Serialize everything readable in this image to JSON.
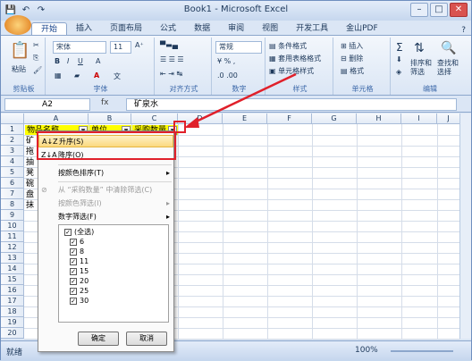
{
  "window": {
    "title": "Book1 - Microsoft Excel",
    "qat": [
      "save-icon",
      "undo-icon",
      "redo-icon"
    ],
    "controls": [
      "minimize-icon",
      "restore-icon",
      "close-icon"
    ]
  },
  "tabs": [
    "开始",
    "插入",
    "页面布局",
    "公式",
    "数据",
    "审阅",
    "视图",
    "开发工具",
    "金山PDF"
  ],
  "ribbon": {
    "clipboard": {
      "label": "剪贴板",
      "paste": "粘贴"
    },
    "font": {
      "label": "字体",
      "name": "宋体",
      "size": "11"
    },
    "alignment": {
      "label": "对齐方式"
    },
    "number": {
      "label": "数字",
      "format": "常规"
    },
    "styles": {
      "label": "样式",
      "conditional": "条件格式",
      "table": "套用表格格式",
      "cell": "单元格样式"
    },
    "cells": {
      "label": "单元格",
      "insert": "插入",
      "delete": "删除",
      "format": "格式"
    },
    "editing": {
      "label": "编辑",
      "sort": "排序和\n筛选",
      "find": "查找和\n选择"
    }
  },
  "formula_bar": {
    "name_box": "A2",
    "fx": "fx",
    "content": "矿泉水"
  },
  "grid": {
    "columns": [
      "A",
      "B",
      "C",
      "D",
      "E",
      "F",
      "G",
      "H",
      "I",
      "J"
    ],
    "rows": [
      "1",
      "2",
      "3",
      "4",
      "5",
      "6",
      "7",
      "8",
      "9",
      "10",
      "11",
      "12",
      "13",
      "14",
      "15",
      "16",
      "17",
      "18",
      "19",
      "20"
    ],
    "header_cells": [
      "物品名称",
      "单位",
      "采购数量"
    ],
    "col_a_partial": [
      "矿",
      "拖",
      "抽",
      "凳",
      "碗",
      "盘",
      "抹"
    ]
  },
  "filter_menu": {
    "sort_asc": "升序(S)",
    "sort_desc": "降序(O)",
    "sort_by_color": "按颜色排序(T)",
    "clear_filter": "从 “采购数量” 中清除筛选(C)",
    "filter_by_color": "按颜色筛选(I)",
    "number_filter": "数字筛选(F)",
    "items": [
      "(全选)",
      "6",
      "8",
      "11",
      "15",
      "20",
      "25",
      "30"
    ],
    "ok": "确定",
    "cancel": "取消"
  },
  "status": {
    "ready": "就绪",
    "zoom": "100%"
  },
  "colors": {
    "accent": "#15428b",
    "highlight": "#ffff00",
    "annotation": "#e0202a"
  }
}
